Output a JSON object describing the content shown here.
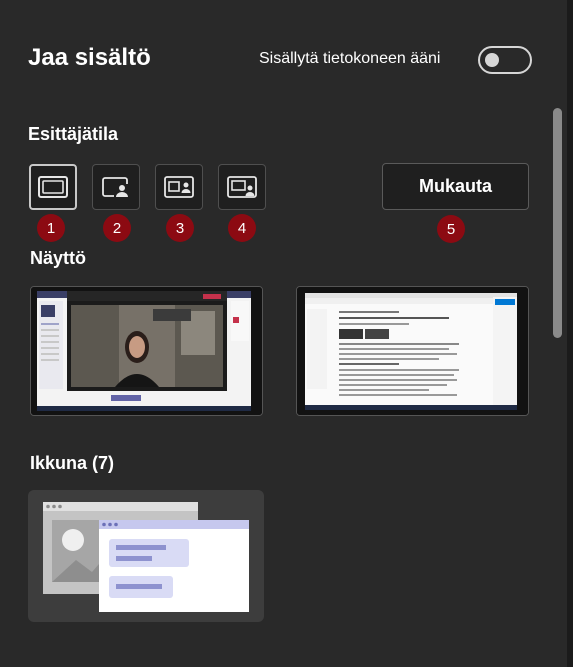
{
  "header": {
    "title": "Jaa sisältö",
    "include_sound_label": "Sisällytä tietokoneen ääni",
    "include_sound_on": false
  },
  "presenter_mode": {
    "label": "Esittäjätila",
    "modes": [
      {
        "icon": "content-only-icon",
        "badge": "1",
        "selected": true
      },
      {
        "icon": "standout-icon",
        "badge": "2",
        "selected": false
      },
      {
        "icon": "side-by-side-icon",
        "badge": "3",
        "selected": false
      },
      {
        "icon": "reporter-icon",
        "badge": "4",
        "selected": false
      }
    ],
    "customize_label": "Mukauta",
    "customize_badge": "5"
  },
  "screens": {
    "label": "Näyttö",
    "items": [
      {
        "name": "screen-1",
        "preview": "teams-meeting-window"
      },
      {
        "name": "screen-2",
        "preview": "document-editor-window"
      }
    ]
  },
  "windows": {
    "label": "Ikkuna (7)"
  },
  "colors": {
    "background": "#292929",
    "badge": "#8c0a12",
    "button_bg": "#1f1f1f",
    "tile_bg": "#3d3d3d",
    "accent_lavender": "#c6c8ee",
    "accent_purple": "#8e92cf"
  }
}
